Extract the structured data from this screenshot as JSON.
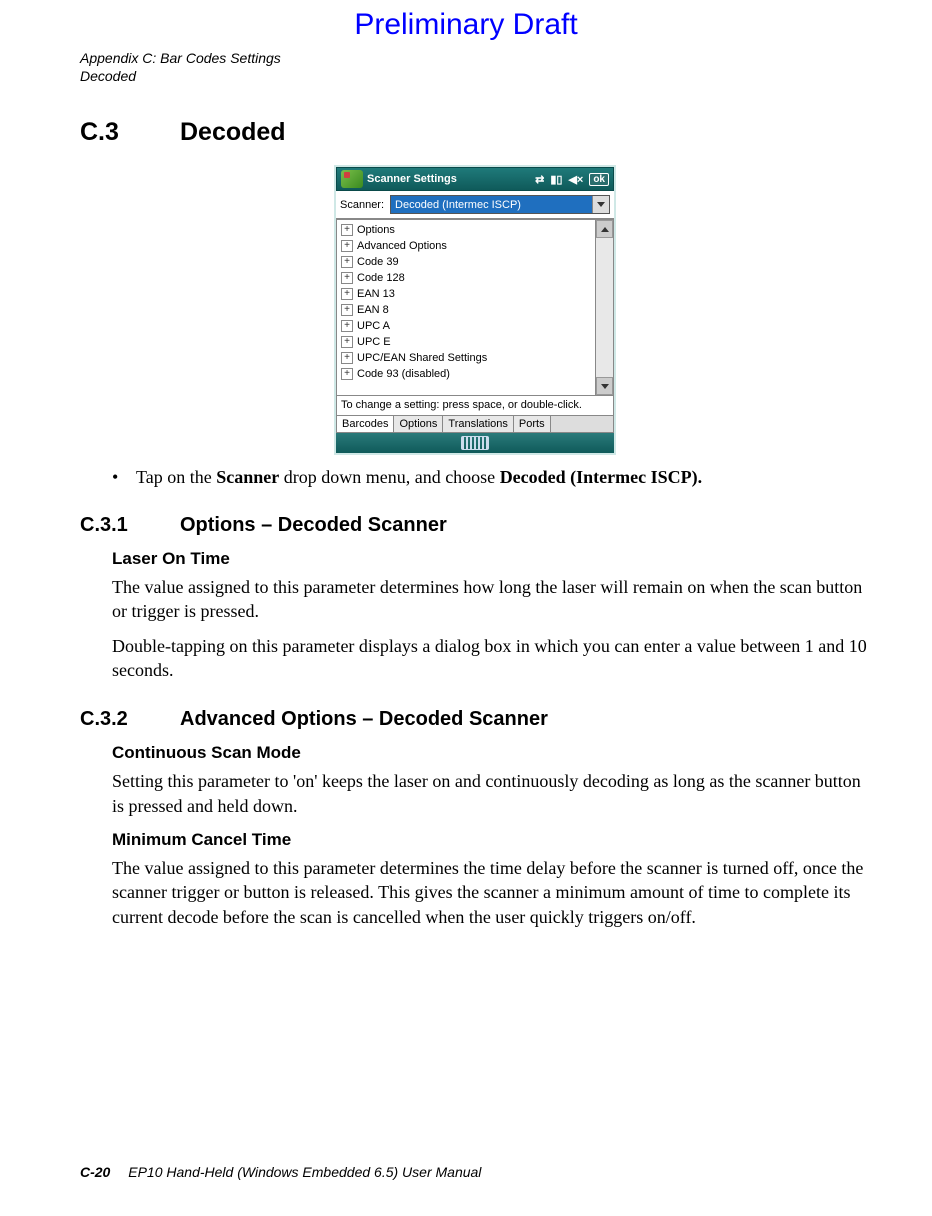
{
  "watermark": "Preliminary Draft",
  "header": {
    "line1": "Appendix C: Bar Codes Settings",
    "line2": "Decoded"
  },
  "section": {
    "num": "C.3",
    "title": "Decoded"
  },
  "screenshot": {
    "title": "Scanner Settings",
    "ok": "ok",
    "scanner_label": "Scanner:",
    "scanner_value": "Decoded (Intermec ISCP)",
    "tree": [
      "Options",
      "Advanced Options",
      "Code 39",
      "Code 128",
      "EAN 13",
      "EAN 8",
      "UPC A",
      "UPC E",
      "UPC/EAN Shared Settings",
      "Code 93 (disabled)"
    ],
    "hint": "To change a setting: press space, or double-click.",
    "tabs": [
      "Barcodes",
      "Options",
      "Translations",
      "Ports"
    ]
  },
  "bullet": {
    "pre": "Tap on the ",
    "b1": "Scanner",
    "mid": " drop down menu, and choose ",
    "b2": "Decoded (Intermec ISCP)."
  },
  "sub1": {
    "num": "C.3.1",
    "title": "Options – Decoded Scanner"
  },
  "laser": {
    "h": "Laser On Time",
    "p1": "The value assigned to this parameter determines how long the laser will remain on when the scan button or trigger is pressed.",
    "p2": "Double-tapping on this parameter displays a dialog box in which you can enter a value between 1 and 10 seconds."
  },
  "sub2": {
    "num": "C.3.2",
    "title": "Advanced Options – Decoded Scanner"
  },
  "cont": {
    "h": "Continuous Scan Mode",
    "p": "Setting this parameter to 'on' keeps the laser on and continuously decoding as long as the scanner button is pressed and held down."
  },
  "minc": {
    "h": "Minimum Cancel Time",
    "p": "The value assigned to this parameter determines the time delay before the scanner is turned off, once the scanner trigger or button is released. This gives the scanner a minimum amount of time to complete its current decode before the scan is cancelled when the user quickly triggers on/off."
  },
  "footer": {
    "page": "C-20",
    "text": "EP10 Hand-Held (Windows Embedded 6.5) User Manual"
  }
}
